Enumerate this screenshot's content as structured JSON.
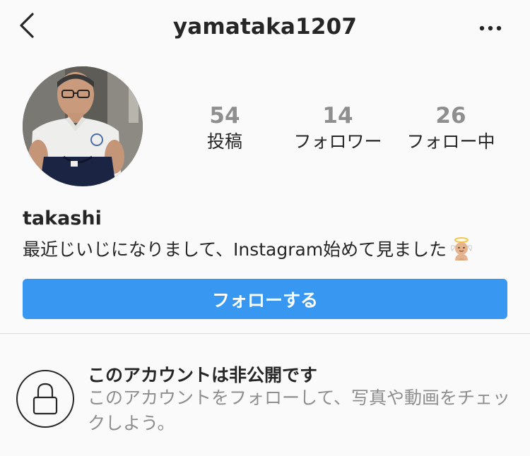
{
  "header": {
    "username": "yamataka1207",
    "back_icon": "chevron-left-icon",
    "more_icon": "more-horizontal-icon"
  },
  "profile": {
    "avatar_icon": "profile-photo",
    "stats": [
      {
        "value": "54",
        "label": "投稿"
      },
      {
        "value": "14",
        "label": "フォロワー"
      },
      {
        "value": "26",
        "label": "フォロー中"
      }
    ],
    "full_name": "takashi",
    "bio": "最近じいじになりまして、Instagram始めて見ました",
    "bio_emoji": "baby-angel-emoji"
  },
  "follow_button": {
    "label": "フォローする",
    "color": "#3897f0"
  },
  "private_notice": {
    "icon": "lock-icon",
    "title": "このアカウントは非公開です",
    "description": "このアカウントをフォローして、写真や動画をチェックしよう。"
  }
}
